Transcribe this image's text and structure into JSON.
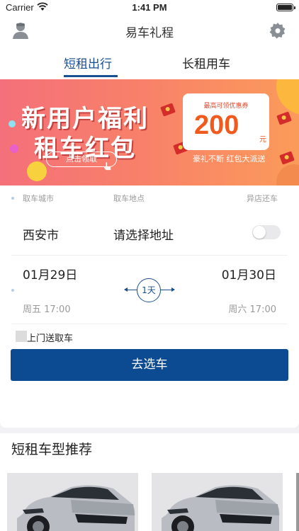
{
  "status": {
    "carrier": "Carrier",
    "time": "1:41 PM"
  },
  "nav": {
    "title": "易车礼程"
  },
  "tabs": [
    {
      "label": "短租出行",
      "active": true
    },
    {
      "label": "长租用车",
      "active": false
    }
  ],
  "banner": {
    "headline1": "新用户福利",
    "headline2": "租车红包",
    "claim_label": "点击领取",
    "coupon_label": "最高可领优惠券",
    "coupon_amount": "200",
    "coupon_unit": "元",
    "slogan": "豪礼不断  红包大派送"
  },
  "booking": {
    "labels": {
      "city": "取车城市",
      "place": "取车地点",
      "return": "异店还车"
    },
    "city": "西安市",
    "address_placeholder": "请选择地址",
    "return_elsewhere": false,
    "pickup": {
      "date": "01月29日",
      "weekday_time": "周五 17:00"
    },
    "dropoff": {
      "date": "01月30日",
      "weekday_time": "周六 17:00"
    },
    "duration": "1天",
    "door_delivery_label": "上门送取车",
    "door_delivery_checked": false,
    "submit_label": "去选车"
  },
  "recommend": {
    "title": "短租车型推荐"
  },
  "colors": {
    "accent": "#1b4f93",
    "button": "#0c4a92"
  }
}
